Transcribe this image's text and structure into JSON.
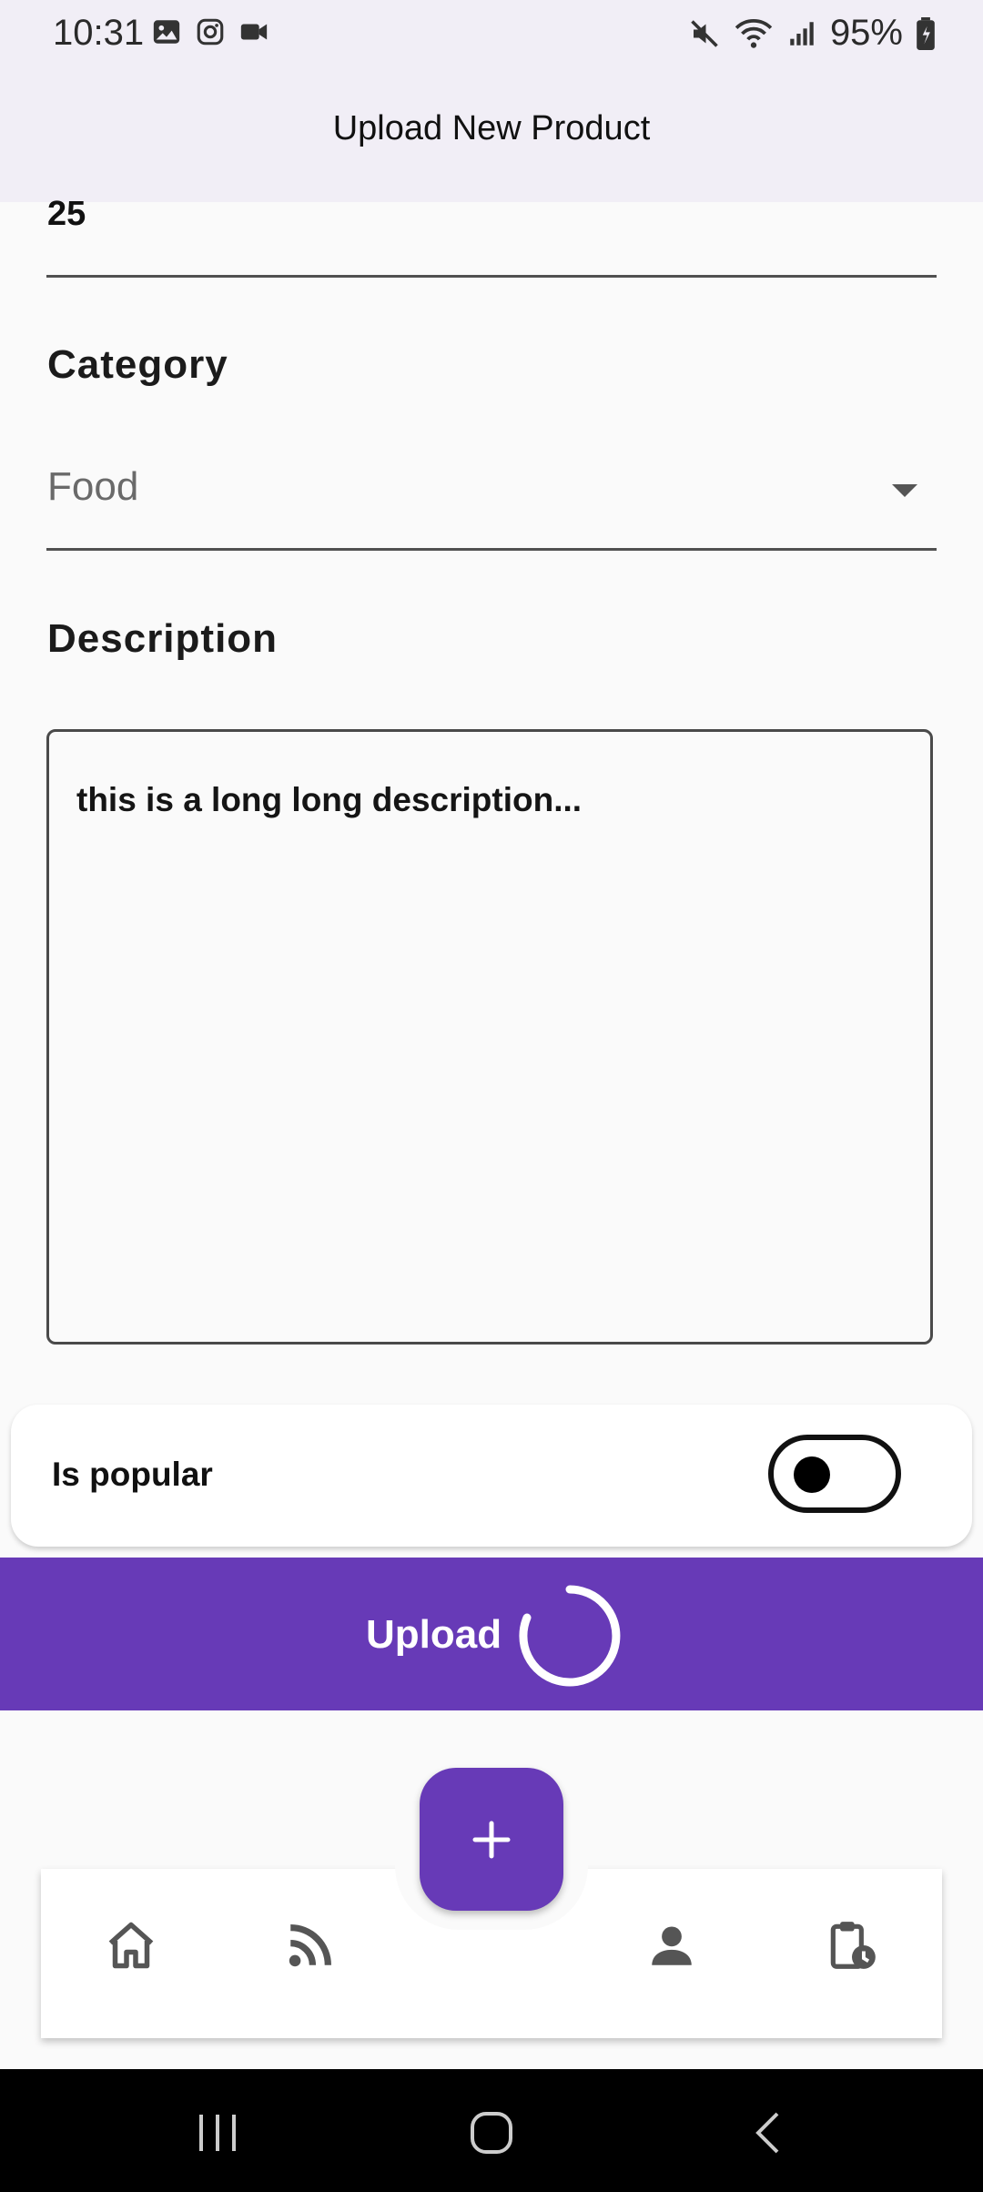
{
  "status_bar": {
    "time": "10:31",
    "battery": "95%",
    "left_icons": [
      "gallery-icon",
      "instagram-icon",
      "video-icon"
    ],
    "right_icons": [
      "mute-icon",
      "wifi-icon",
      "signal-icon",
      "battery-icon"
    ]
  },
  "app_bar": {
    "title": "Upload New Product"
  },
  "form": {
    "previous_field_value": "25",
    "category": {
      "label": "Category",
      "value": "Food"
    },
    "description": {
      "label": "Description",
      "value": "this is a long long description..."
    },
    "is_popular": {
      "label": "Is popular",
      "checked": false
    }
  },
  "upload": {
    "label": "Upload",
    "loading": true
  },
  "bottom_nav": {
    "items": [
      "home-icon",
      "feed-icon",
      "profile-icon",
      "orders-history-icon"
    ],
    "fab": "add-icon"
  },
  "colors": {
    "primary": "#673ab7",
    "app_bar_bg": "#f1eef6",
    "background": "#fafafa"
  }
}
